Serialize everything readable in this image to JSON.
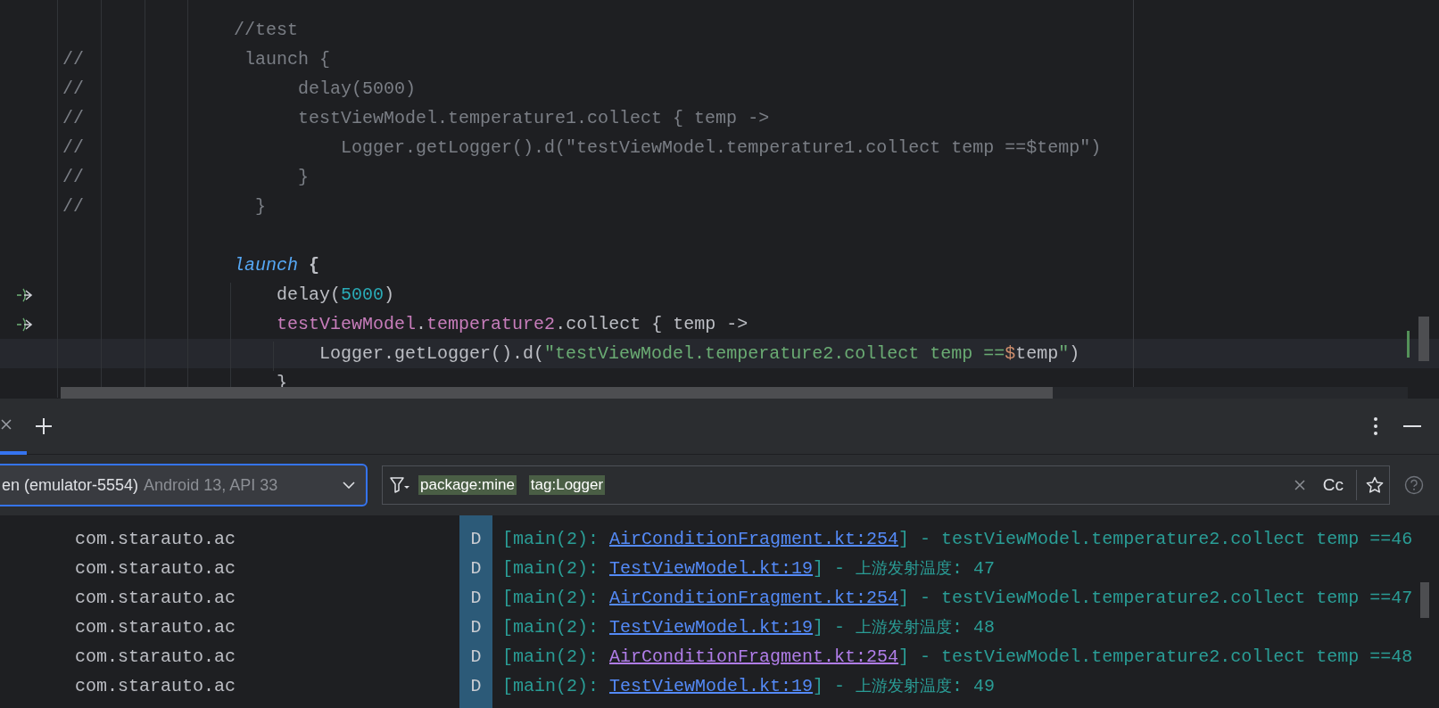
{
  "editor": {
    "lines": [
      {
        "suspend_call": false,
        "current": false,
        "segments": [
          {
            "kind": "comment",
            "text": "                //test"
          }
        ]
      },
      {
        "suspend_call": false,
        "current": false,
        "segments": [
          {
            "kind": "comment",
            "text": "//               launch {"
          }
        ]
      },
      {
        "suspend_call": false,
        "current": false,
        "segments": [
          {
            "kind": "comment",
            "text": "//                    delay(5000)"
          }
        ]
      },
      {
        "suspend_call": false,
        "current": false,
        "segments": [
          {
            "kind": "comment",
            "text": "//                    testViewModel.temperature1.collect { temp ->"
          }
        ]
      },
      {
        "suspend_call": false,
        "current": false,
        "segments": [
          {
            "kind": "comment",
            "text": "//                        Logger.getLogger().d(\"testViewModel.temperature1.collect temp ==$temp\")"
          }
        ]
      },
      {
        "suspend_call": false,
        "current": false,
        "segments": [
          {
            "kind": "comment",
            "text": "//                    }"
          }
        ]
      },
      {
        "suspend_call": false,
        "current": false,
        "segments": [
          {
            "kind": "comment",
            "text": "//                }"
          }
        ]
      },
      {
        "suspend_call": false,
        "current": false
      },
      {
        "suspend_call": false,
        "current": false,
        "segments": [
          {
            "kind": "call",
            "text": "                launch"
          },
          {
            "kind": "brace",
            "text": " {"
          }
        ]
      },
      {
        "suspend_call": true,
        "current": false,
        "segments": [
          {
            "kind": "plain",
            "text": "                    delay("
          },
          {
            "kind": "number",
            "text": "5000"
          },
          {
            "kind": "plain",
            "text": ")"
          }
        ]
      },
      {
        "suspend_call": true,
        "current": false,
        "segments": [
          {
            "kind": "property",
            "text": "                    testViewModel"
          },
          {
            "kind": "plain",
            "text": "."
          },
          {
            "kind": "property",
            "text": "temperature2"
          },
          {
            "kind": "plain",
            "text": ".collect { temp ->"
          }
        ]
      },
      {
        "suspend_call": false,
        "current": true,
        "segments": [
          {
            "kind": "plain",
            "text": "                        Logger.getLogger().d("
          },
          {
            "kind": "string",
            "text": "\"testViewModel.temperature2.collect temp =="
          },
          {
            "kind": "template",
            "text": "$"
          },
          {
            "kind": "plain",
            "text": "temp"
          },
          {
            "kind": "string",
            "text": "\""
          },
          {
            "kind": "plain",
            "text": ")"
          }
        ]
      },
      {
        "suspend_call": false,
        "current": false,
        "segments": [
          {
            "kind": "plain",
            "text": "                    }"
          }
        ]
      }
    ]
  },
  "logcat": {
    "tab": {
      "selected": true
    },
    "device": {
      "name": "en (emulator-5554)",
      "detail": "Android 13, API 33"
    },
    "filter": {
      "chips": [
        "package:mine",
        "tag:Logger"
      ],
      "case_button": "Cc"
    },
    "rows": [
      {
        "package": "com.starauto.ac",
        "level": "D",
        "prefix": "[main(2): ",
        "link": "AirConditionFragment.kt:254",
        "visited": false,
        "message": "] - testViewModel.temperature2.collect temp ==46"
      },
      {
        "package": "com.starauto.ac",
        "level": "D",
        "prefix": "[main(2): ",
        "link": "TestViewModel.kt:19",
        "visited": false,
        "message": "] - 上游发射温度: 47"
      },
      {
        "package": "com.starauto.ac",
        "level": "D",
        "prefix": "[main(2): ",
        "link": "AirConditionFragment.kt:254",
        "visited": false,
        "message": "] - testViewModel.temperature2.collect temp ==47"
      },
      {
        "package": "com.starauto.ac",
        "level": "D",
        "prefix": "[main(2): ",
        "link": "TestViewModel.kt:19",
        "visited": false,
        "message": "] - 上游发射温度: 48"
      },
      {
        "package": "com.starauto.ac",
        "level": "D",
        "prefix": "[main(2): ",
        "link": "AirConditionFragment.kt:254",
        "visited": true,
        "message": "] - testViewModel.temperature2.collect temp ==48"
      },
      {
        "package": "com.starauto.ac",
        "level": "D",
        "prefix": "[main(2): ",
        "link": "TestViewModel.kt:19",
        "visited": false,
        "message": "] - 上游发射温度: 49"
      }
    ]
  }
}
